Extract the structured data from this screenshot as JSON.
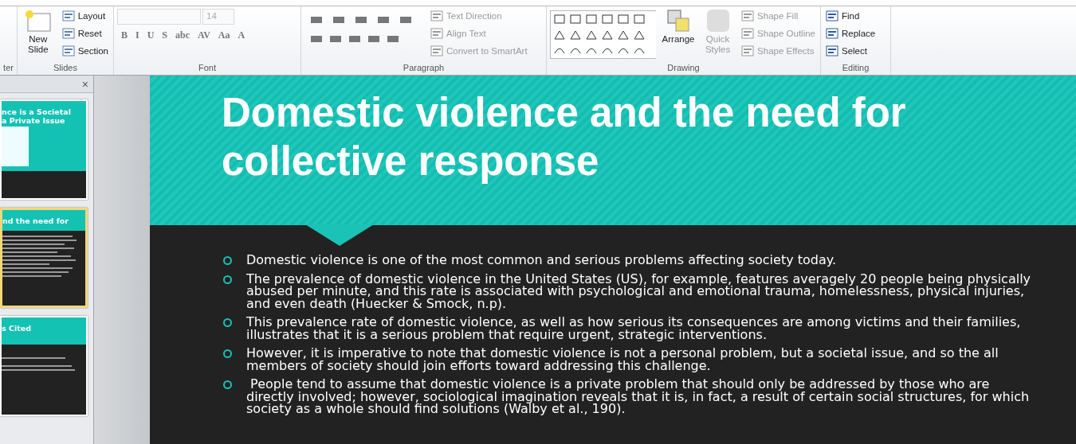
{
  "ribbon": {
    "clipboard_cut": {
      "label": "ter"
    },
    "slides_group": {
      "label": "Slides",
      "new_slide": "New Slide",
      "commands": [
        {
          "label": "Layout"
        },
        {
          "label": "Reset"
        },
        {
          "label": "Section"
        }
      ]
    },
    "font_group": {
      "label": "Font",
      "size": "14",
      "buttons": [
        "B",
        "I",
        "U",
        "S",
        "abc",
        "AV",
        "Aa",
        "A"
      ]
    },
    "paragraph_group": {
      "label": "Paragraph",
      "commands": [
        {
          "label": "Text Direction",
          "disabled": true
        },
        {
          "label": "Align Text",
          "disabled": true
        },
        {
          "label": "Convert to SmartArt",
          "disabled": true
        }
      ]
    },
    "drawing_group": {
      "label": "Drawing",
      "arrange": "Arrange",
      "quick_styles": {
        "label": "Quick Styles",
        "disabled": true
      },
      "commands": [
        {
          "label": "Shape Fill",
          "disabled": true
        },
        {
          "label": "Shape Outline",
          "disabled": true
        },
        {
          "label": "Shape Effects",
          "disabled": true
        }
      ]
    },
    "editing_group": {
      "label": "Editing",
      "commands": [
        {
          "label": "Find"
        },
        {
          "label": "Replace"
        },
        {
          "label": "Select"
        }
      ]
    }
  },
  "thumbnail_panel": {
    "close": "×"
  },
  "thumbnails": [
    {
      "kind": "picture",
      "title_lines": [
        "nce is a Societal",
        "a Private Issue"
      ],
      "selected": false
    },
    {
      "kind": "bullets",
      "title_lines": [
        "nd the need for"
      ],
      "selected": true
    },
    {
      "kind": "references",
      "title_lines": [
        "s Cited"
      ],
      "selected": false
    }
  ],
  "slide": {
    "title_lines": [
      "Domestic violence and the need for",
      "collective response"
    ],
    "bullets": [
      "Domestic violence is one of the most common and serious problems affecting society today.",
      "The prevalence of domestic violence in the United States (US), for example, features averagely 20 people being physically abused per minute, and this rate is associated with psychological and emotional trauma, homelessness, physical injuries, and even death (Huecker & Smock, n.p).",
      "This prevalence rate of domestic violence, as well as how serious its consequences are among victims and their families, illustrates that it is a serious problem that require urgent, strategic interventions.",
      "However, it is imperative to note that domestic violence is not a personal problem, but a societal issue, and so the all members of society should join efforts toward addressing this challenge.",
      " People tend to assume that domestic violence is a private problem that should only be addressed by those who are directly involved; however, sociological imagination reveals that it is, in fact, a result of certain social structures, for which society as a whole should find solutions (Walby et al., 190)."
    ]
  }
}
